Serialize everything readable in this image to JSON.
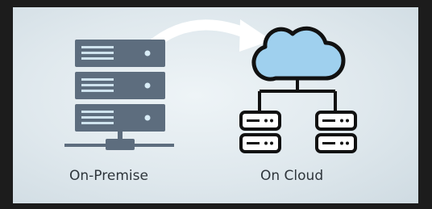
{
  "labels": {
    "on_premise": "On-Premise",
    "on_cloud": "On Cloud"
  },
  "icons": [
    "server-stack-icon",
    "network-base-icon",
    "transfer-arrow-icon",
    "cloud-icon",
    "connector-lines-icon",
    "server-small-left-icon",
    "server-small-right-icon"
  ],
  "colors": {
    "background_outer": "#1c1c1c",
    "panel": "#dfe8ed",
    "server_unit": "#5d6d7e",
    "server_light": "#cfe3ee",
    "cloud_fill": "#9fd0ee",
    "stroke_dark": "#111111",
    "arrow": "#ffffff"
  }
}
